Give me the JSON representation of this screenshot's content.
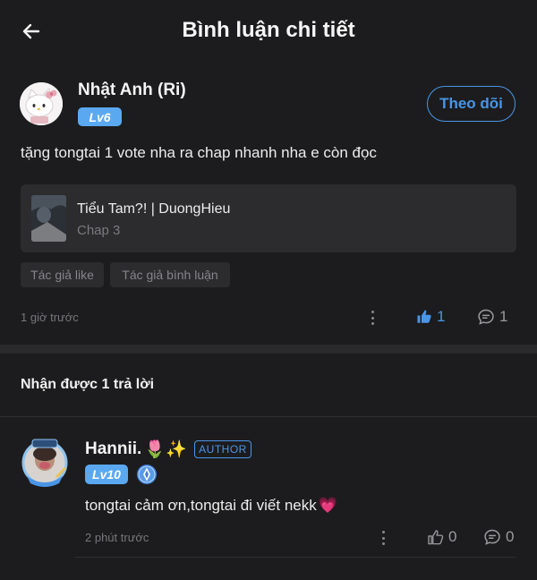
{
  "header": {
    "title": "Bình luận chi tiết",
    "back_icon": "arrow-left-icon"
  },
  "comment": {
    "username": "Nhật Anh (Ri)",
    "level": "Lv6",
    "follow_label": "Theo dõi",
    "text": "tặng tongtai 1 vote nha ra chap nhanh nha e còn đọc",
    "story": {
      "title": "Tiểu Tam?! | DuongHieu",
      "chapter": "Chap 3"
    },
    "tags": [
      "Tác giả like",
      "Tác giả bình luận"
    ],
    "time": "1 giờ trước",
    "likes": "1",
    "replies": "1",
    "liked": true
  },
  "replies_heading": "Nhận được 1 trả lời",
  "reply": {
    "username": "Hannii.",
    "username_emoji": "🌷✨",
    "author_badge": "AUTHOR",
    "level": "Lv10",
    "text": "tongtai cảm ơn,tongtai đi viết nekk",
    "text_emoji": "💗",
    "time": "2 phút trước",
    "likes": "0",
    "replies": "0"
  },
  "colors": {
    "background": "#1c1c1e",
    "accent": "#4a95e6",
    "level_badge": "#5aa8f0",
    "card": "#2c2c2e"
  }
}
